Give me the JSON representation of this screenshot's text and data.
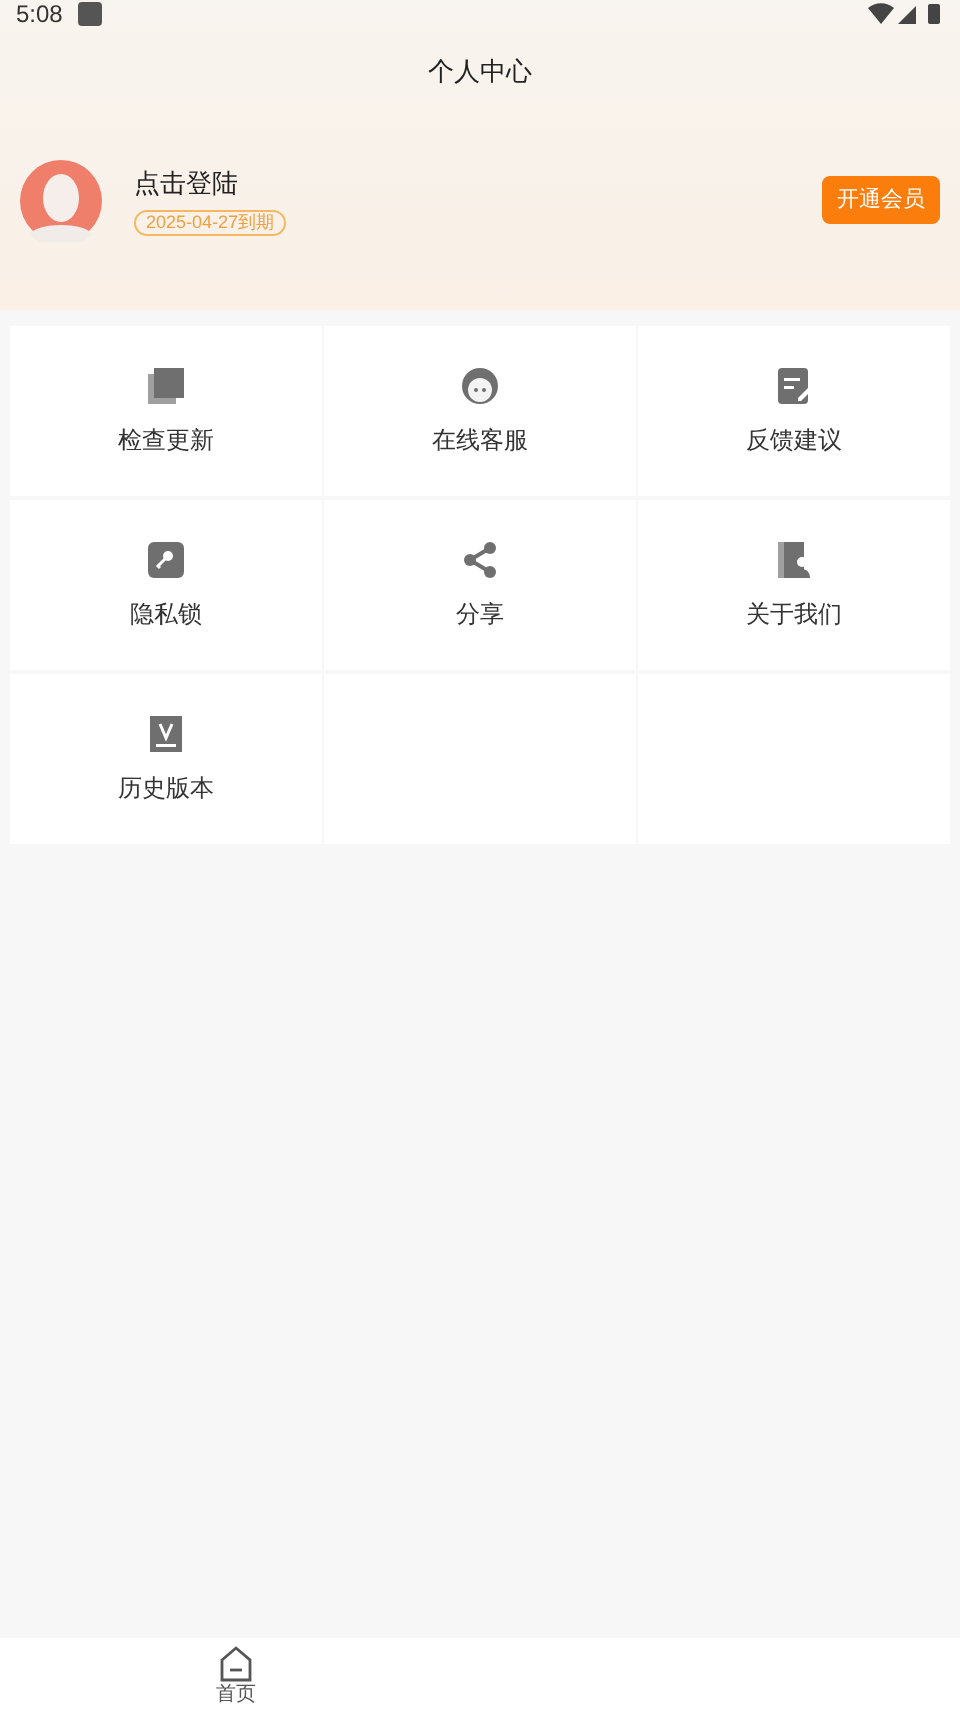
{
  "status_bar": {
    "time": "5:08"
  },
  "header": {
    "title": "个人中心"
  },
  "profile": {
    "name": "点击登陆",
    "expiry": "2025-04-27到期",
    "vip_button": "开通会员"
  },
  "menu": [
    {
      "kind": "update",
      "label": "检查更新"
    },
    {
      "kind": "service",
      "label": "在线客服"
    },
    {
      "kind": "feedback",
      "label": "反馈建议"
    },
    {
      "kind": "lock",
      "label": "隐私锁"
    },
    {
      "kind": "share",
      "label": "分享"
    },
    {
      "kind": "about",
      "label": "关于我们"
    },
    {
      "kind": "history",
      "label": "历史版本"
    }
  ],
  "bottom_nav": [
    {
      "label": "首页",
      "selected": true
    }
  ]
}
